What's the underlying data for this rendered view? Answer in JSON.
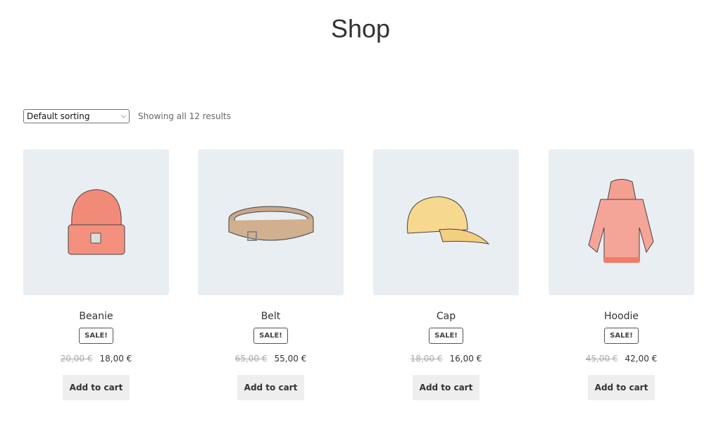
{
  "page": {
    "title": "Shop"
  },
  "toolbar": {
    "sort_selected": "Default sorting",
    "result_count": "Showing all 12 results"
  },
  "products": [
    {
      "name": "Beanie",
      "badge": "SALE!",
      "old_price": "20,00 €",
      "price": "18,00 €",
      "button": "Add to cart",
      "image": "beanie"
    },
    {
      "name": "Belt",
      "badge": "SALE!",
      "old_price": "65,00 €",
      "price": "55,00 €",
      "button": "Add to cart",
      "image": "belt"
    },
    {
      "name": "Cap",
      "badge": "SALE!",
      "old_price": "18,00 €",
      "price": "16,00 €",
      "button": "Add to cart",
      "image": "cap"
    },
    {
      "name": "Hoodie",
      "badge": "SALE!",
      "old_price": "45,00 €",
      "price": "42,00 €",
      "button": "Add to cart",
      "image": "hoodie"
    }
  ]
}
